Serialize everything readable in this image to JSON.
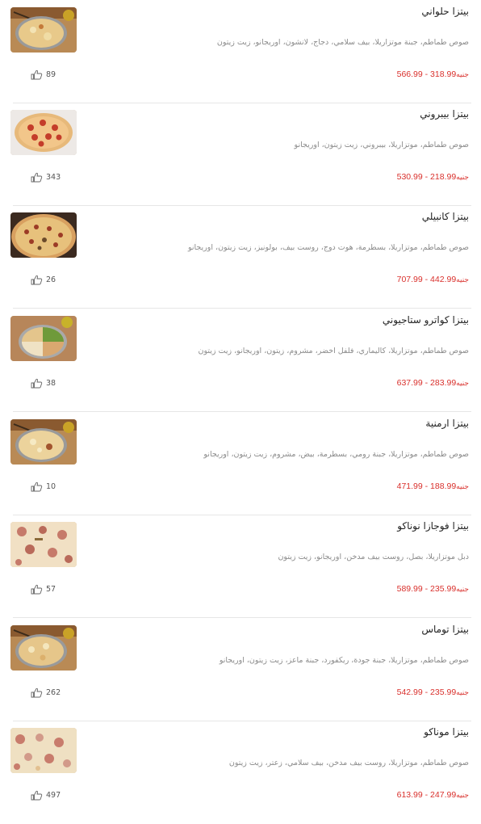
{
  "colors": {
    "price": "#d9302c",
    "title": "#222222",
    "description": "#8b8b8b",
    "separator": "#e6e6e6"
  },
  "items": [
    {
      "title": "بيتزا حلواني",
      "description": "صوص طماطم، جبنة موتزاريلا، بيف سلامي، دجاج، لانشون، اوريجانو، زيت زيتون",
      "price_range": "566.99 - 318.99",
      "currency": "جنيه",
      "likes": "89",
      "image_icon": "pizza-photo-mixed"
    },
    {
      "title": "بيتزا بيبروني",
      "description": "صوص طماطم، موتزاريلا، بيبروني، زيت زيتون، اوريجانو",
      "price_range": "530.99 - 218.99",
      "currency": "جنيه",
      "likes": "343",
      "image_icon": "pizza-photo-pepperoni"
    },
    {
      "title": "بيتزا كانبيلي",
      "description": "صوص طماطم، موتزاريلا، بسطرمة، هوت دوج، روست بيف، بولونيز، زيت زيتون، اوريجانو",
      "price_range": "707.99 - 442.99",
      "currency": "جنيه",
      "likes": "26",
      "image_icon": "pizza-photo-meat"
    },
    {
      "title": "بيتزا كواترو ستاجيوني",
      "description": "صوص طماطم، موتزاريلا، كاليماري، فلفل اخضر، مشروم، زيتون، اوريجانو، زيت زيتون",
      "price_range": "637.99 - 283.99",
      "currency": "جنيه",
      "likes": "38",
      "image_icon": "pizza-photo-four-seasons"
    },
    {
      "title": "بيتزا ارمنية",
      "description": "صوص طماطم، موتزاريلا، جبنة رومي، بسطرمة، بيض، مشروم، زيت زيتون، اوريجانو",
      "price_range": "471.99 - 188.99",
      "currency": "جنيه",
      "likes": "10",
      "image_icon": "pizza-photo-mixed"
    },
    {
      "title": "بيتزا فوجازا نوناكو",
      "description": "دبل موتزاريلا، بصل، روست بيف مدخن، اوريجانو، زيت زيتون",
      "price_range": "589.99 - 235.99",
      "currency": "جنيه",
      "likes": "57",
      "image_icon": "pizza-photo-slice"
    },
    {
      "title": "بيتزا توماس",
      "description": "صوص طماطم، موتزاريلا، جبنة جودة، ريكفورد، جبنة ماعز، زيت زيتون، اوريجانو",
      "price_range": "542.99 - 235.99",
      "currency": "جنيه",
      "likes": "262",
      "image_icon": "pizza-photo-mixed"
    },
    {
      "title": "بيتزا موناكو",
      "description": "صوص طماطم، موتزاريلا، روست بيف مدخن، بيف سلامي، زعتر، زيت زيتون",
      "price_range": "613.99 - 247.99",
      "currency": "جنيه",
      "likes": "497",
      "image_icon": "pizza-photo-slice"
    }
  ]
}
